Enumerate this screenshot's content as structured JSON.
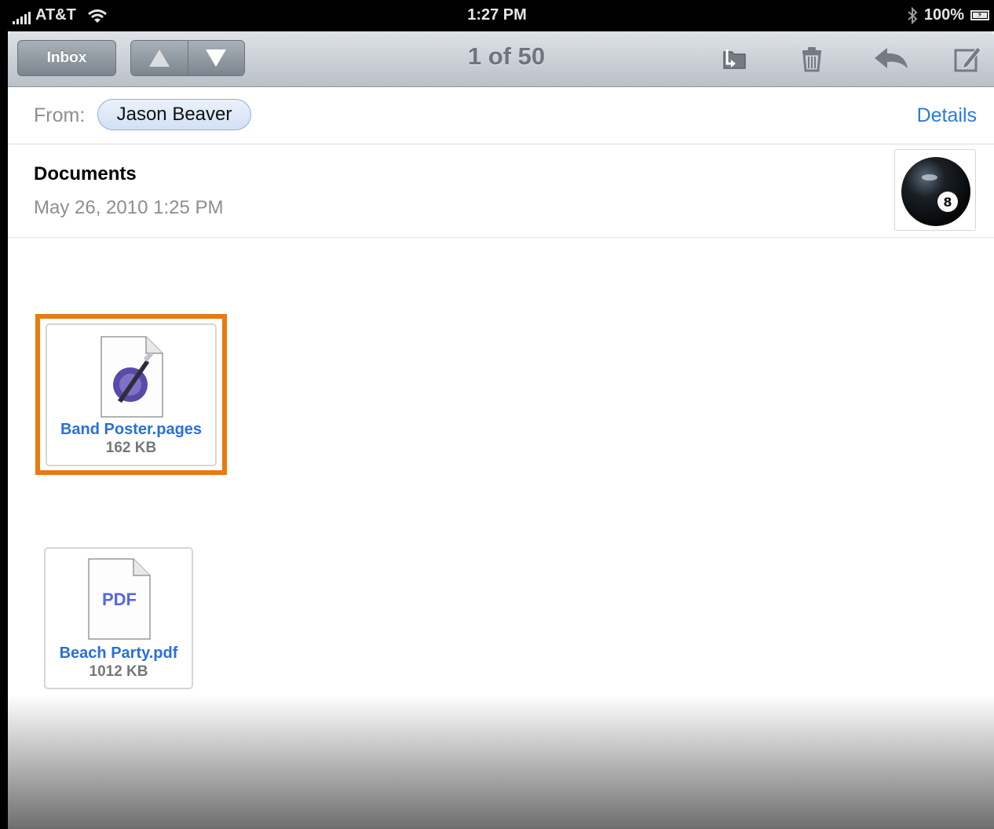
{
  "status_bar": {
    "carrier": "AT&T",
    "time": "1:27 PM",
    "battery": "100%",
    "icons": [
      "signal-bars-icon",
      "wifi-icon",
      "bluetooth-icon",
      "battery-charging-icon"
    ]
  },
  "toolbar": {
    "inbox_label": "Inbox",
    "counter": "1 of 50",
    "icons": [
      "previous-arrow-icon",
      "next-arrow-icon",
      "move-to-folder-icon",
      "trash-icon",
      "reply-icon",
      "compose-icon"
    ]
  },
  "message": {
    "from_label": "From:",
    "sender": "Jason Beaver",
    "details_label": "Details",
    "subject": "Documents",
    "date": "May 26, 2010 1:25 PM"
  },
  "attachments": [
    {
      "name": "Band Poster.pages",
      "size": "162 KB",
      "icon": "pages-document-icon",
      "highlighted": true
    },
    {
      "name": "Beach Party.pdf",
      "size": "1012 KB",
      "icon": "pdf-document-icon",
      "icon_label": "PDF",
      "highlighted": false
    }
  ],
  "colors": {
    "link_blue": "#2a7ae2",
    "highlight_orange": "#e87a10",
    "toolbar_gray": "#b9c0c8"
  }
}
